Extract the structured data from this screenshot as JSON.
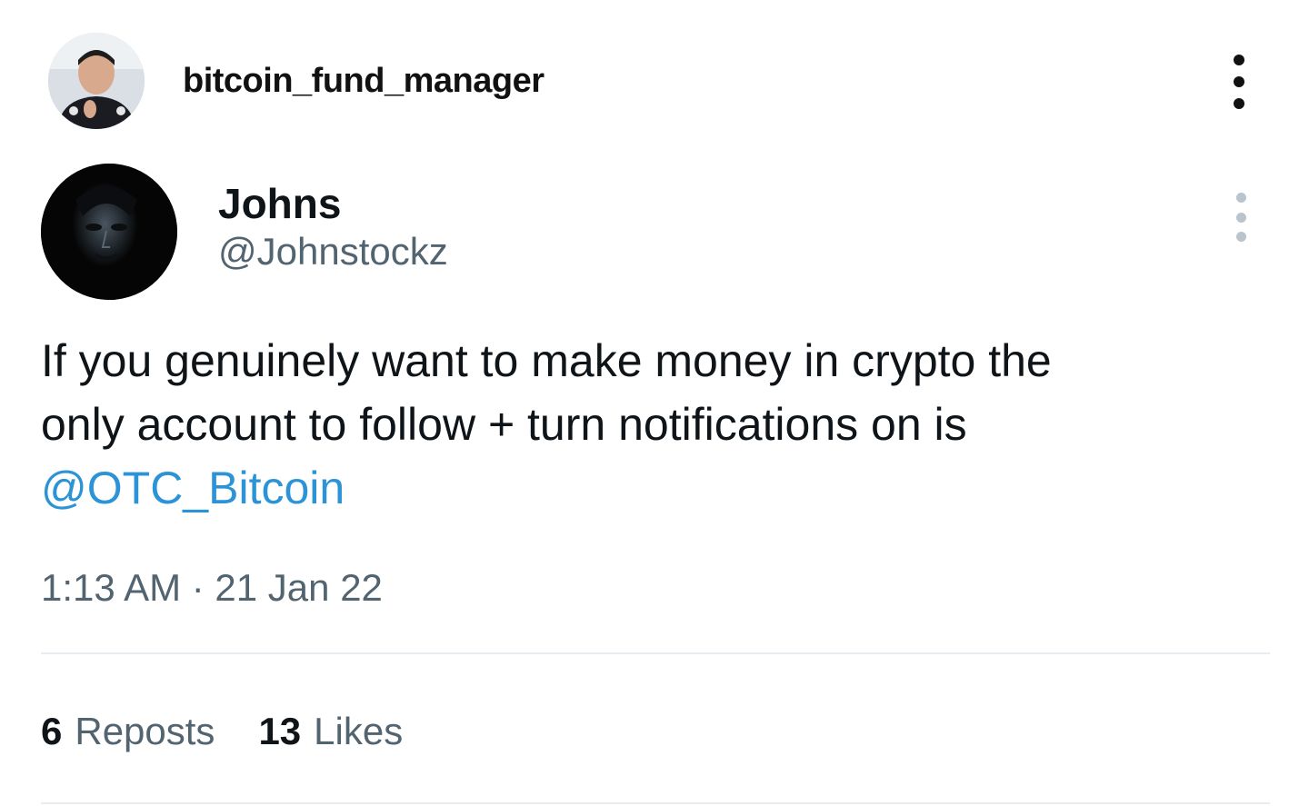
{
  "post": {
    "username": "bitcoin_fund_manager",
    "avatar_icon": "user-photo-avatar",
    "more_icon": "vertical-ellipsis-icon"
  },
  "tweet": {
    "display_name": "Johns",
    "handle": "@Johnstockz",
    "avatar_icon": "dark-masked-face-avatar",
    "more_icon": "vertical-ellipsis-icon",
    "text_lines": [
      "If you genuinely want to make money in crypto the",
      "only account to follow + turn notifications on is"
    ],
    "mention": "@OTC_Bitcoin",
    "timestamp": "1:13 AM · 21 Jan 22",
    "reposts_count": "6",
    "reposts_label": "Reposts",
    "likes_count": "13",
    "likes_label": "Likes"
  },
  "colors": {
    "text": "#0f1419",
    "secondary": "#536471",
    "link": "#2c93d6",
    "divider": "#e6ecf0"
  }
}
